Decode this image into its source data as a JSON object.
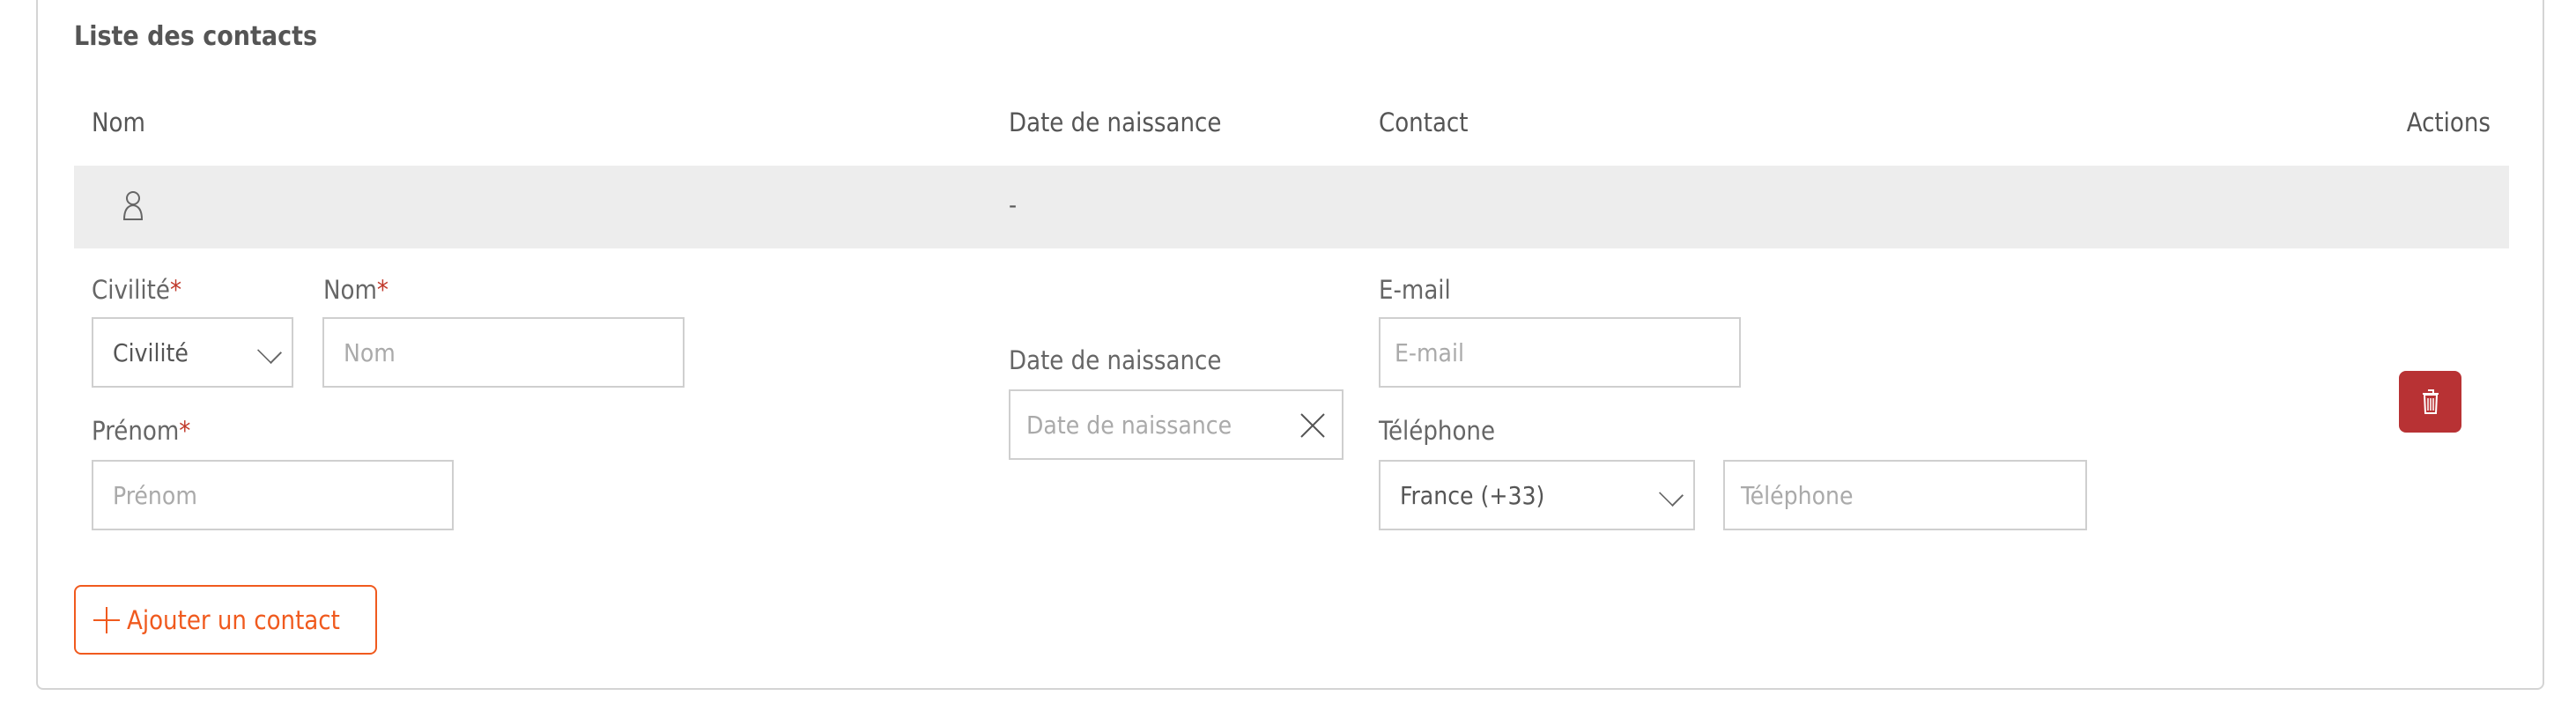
{
  "section_title": "Liste des contacts",
  "table": {
    "headers": {
      "name": "Nom",
      "birthdate": "Date de naissance",
      "contact": "Contact",
      "actions": "Actions"
    },
    "row": {
      "icon": "person-icon",
      "birthdate": "-"
    }
  },
  "form": {
    "civility": {
      "label": "Civilité",
      "value": "Civilité"
    },
    "last_name": {
      "label": "Nom",
      "placeholder": "Nom"
    },
    "first_name": {
      "label": "Prénom",
      "placeholder": "Prénom"
    },
    "birthdate": {
      "label": "Date de naissance",
      "placeholder": "Date de naissance"
    },
    "email": {
      "label": "E-mail",
      "placeholder": "E-mail"
    },
    "phone": {
      "label": "Téléphone",
      "country": "France (+33)",
      "placeholder": "Téléphone"
    },
    "required_mark": "*"
  },
  "add_button": {
    "label": "Ajouter un contact"
  },
  "colors": {
    "accent": "#f05a1e",
    "danger": "#b83234",
    "row_bg": "#ededed"
  }
}
